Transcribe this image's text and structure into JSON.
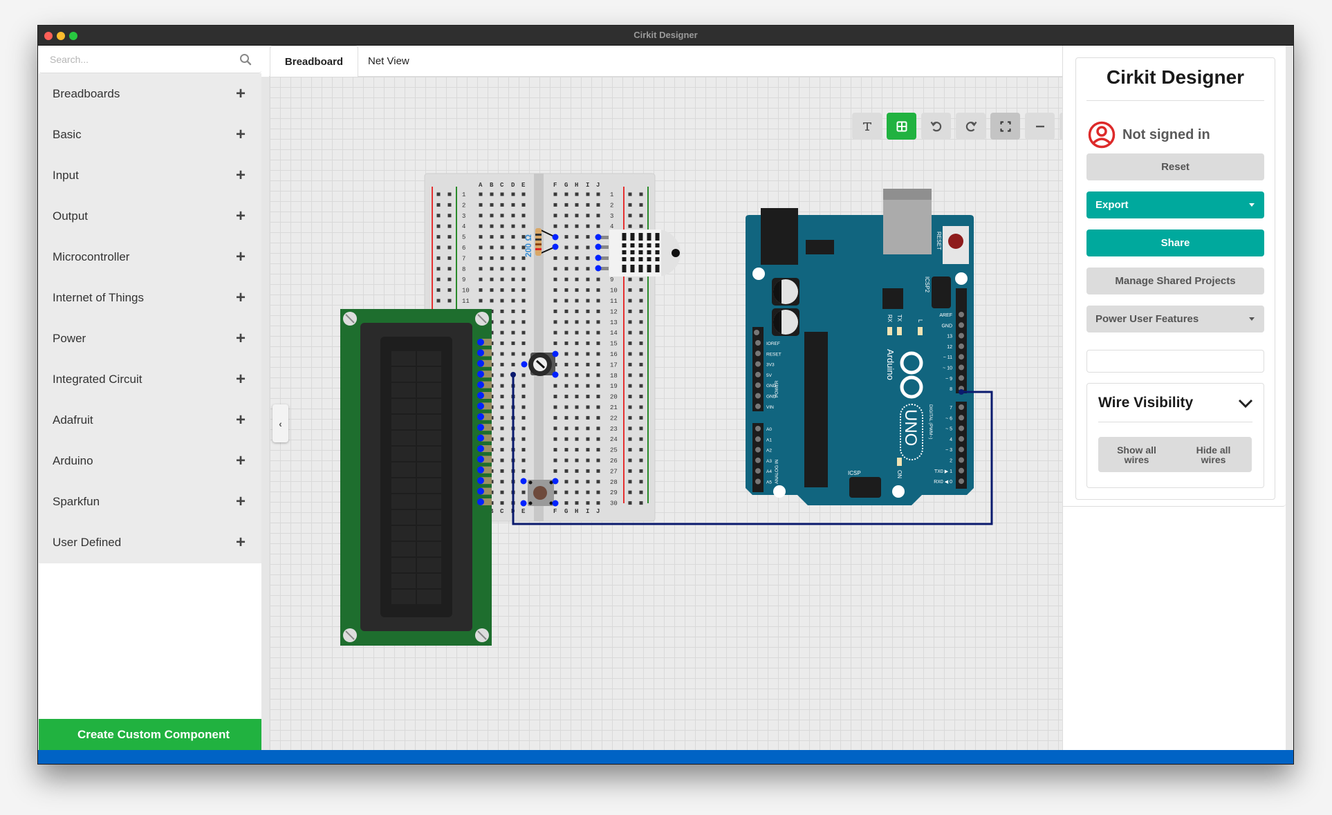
{
  "window": {
    "title": "Cirkit Designer"
  },
  "sidebar": {
    "search_placeholder": "Search...",
    "categories": [
      {
        "label": "Breadboards"
      },
      {
        "label": "Basic"
      },
      {
        "label": "Input"
      },
      {
        "label": "Output"
      },
      {
        "label": "Microcontroller"
      },
      {
        "label": "Internet of Things"
      },
      {
        "label": "Power"
      },
      {
        "label": "Integrated Circuit"
      },
      {
        "label": "Adafruit"
      },
      {
        "label": "Arduino"
      },
      {
        "label": "Sparkfun"
      },
      {
        "label": "User Defined"
      }
    ],
    "expand_symbol": "+",
    "create_button": "Create Custom Component"
  },
  "tabs": [
    {
      "label": "Breadboard",
      "active": true
    },
    {
      "label": "Net View",
      "active": false
    }
  ],
  "toolbar": {
    "buttons": [
      {
        "name": "text-tool",
        "icon": "T",
        "state": "normal"
      },
      {
        "name": "grid-toggle",
        "icon": "grid",
        "state": "active"
      },
      {
        "name": "undo",
        "icon": "undo",
        "state": "normal"
      },
      {
        "name": "redo",
        "icon": "redo",
        "state": "normal"
      },
      {
        "name": "fit-screen",
        "icon": "fullscreen",
        "state": "pressed"
      },
      {
        "name": "zoom-out",
        "icon": "−",
        "state": "normal"
      },
      {
        "name": "zoom-in",
        "icon": "+",
        "state": "normal"
      }
    ]
  },
  "canvas": {
    "collapse_left": "‹",
    "collapse_right": "›",
    "breadboard": {
      "columns_left": [
        "A",
        "B",
        "C",
        "D",
        "E"
      ],
      "columns_right": [
        "F",
        "G",
        "H",
        "I",
        "J"
      ],
      "rows": 30
    },
    "resistor_label": "200 Ω",
    "arduino": {
      "brand": "Arduino",
      "model": "UNO",
      "labels": {
        "reset": "RESET",
        "icsp2": "ICSP2",
        "icsp": "ICSP",
        "rx": "RX",
        "tx": "TX",
        "l": "L",
        "on": "ON",
        "digital": "DIGITAL (PWM~)",
        "power": "POWER",
        "analog": "ANALOG IN"
      },
      "power_pins": [
        "IOREF",
        "RESET",
        "3V3",
        "5V",
        "GND",
        "GND",
        "VIN"
      ],
      "analog_pins": [
        "A0",
        "A1",
        "A2",
        "A3",
        "A4",
        "A5"
      ],
      "digital_pins_top": [
        "AREF",
        "GND",
        "13",
        "12",
        "~ 11",
        "~ 10",
        "~ 9",
        "8"
      ],
      "digital_pins_bottom": [
        "7",
        "~ 6",
        "~ 5",
        "4",
        "~ 3",
        "2",
        "TX0 ▶ 1",
        "RX0 ◀ 0"
      ]
    },
    "colors": {
      "wire": "#0a1a6e",
      "pin_highlight": "#0022ff",
      "lcd_pcb": "#1e6e2e",
      "arduino_pcb": "#11657f"
    }
  },
  "right_panel": {
    "title": "Cirkit Designer",
    "user_status": "Not signed in",
    "buttons": {
      "reset": "Reset",
      "export": "Export",
      "share": "Share",
      "manage": "Manage Shared Projects",
      "power_user": "Power User Features"
    },
    "wire_visibility": {
      "title": "Wire Visibility",
      "show_all": "Show all wires",
      "hide_all": "Hide all wires"
    }
  },
  "colors": {
    "accent_green": "#21b240",
    "teal": "#00a99d",
    "status_blue": "#0063c5",
    "user_red": "#dd2a2a"
  }
}
